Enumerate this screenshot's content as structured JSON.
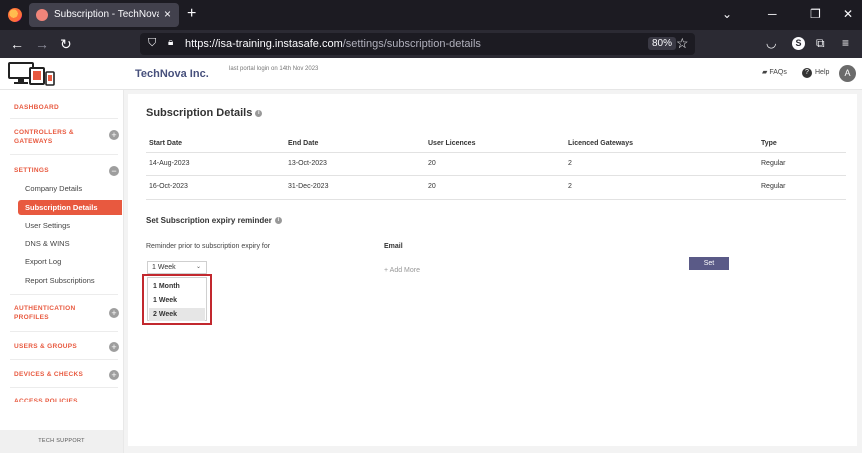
{
  "browser": {
    "tab_title": "Subscription - TechNova Inc. | InstaSafe",
    "tab_close": "×",
    "new_tab": "+",
    "url_host": "https://isa-training.instasafe.com",
    "url_path": "/settings/subscription-details",
    "zoom": "80%",
    "profile_initial": "S"
  },
  "header": {
    "company": "TechNova Inc.",
    "last_login": "last portal login on 14th Nov 2023",
    "faqs": "FAQs",
    "help": "Help",
    "help_glyph": "?",
    "user_initial": "A"
  },
  "sidebar": {
    "dashboard": "DASHBOARD",
    "controllers_line1": "CONTROLLERS &",
    "controllers_line2": "GATEWAYS",
    "settings": "SETTINGS",
    "settings_items": [
      "Company Details",
      "Subscription Details",
      "User Settings",
      "DNS & WINS",
      "Export Log",
      "Report Subscriptions"
    ],
    "auth_line1": "AUTHENTICATION",
    "auth_line2": "PROFILES",
    "users_groups": "USERS & GROUPS",
    "devices_checks": "DEVICES & CHECKS",
    "access_policies": "ACCESS POLICIES",
    "tech_support": "TECH SUPPORT",
    "expand_glyph": "+",
    "collapse_glyph": "−"
  },
  "main": {
    "title": "Subscription Details",
    "info_glyph": "i",
    "columns": [
      "Start Date",
      "End Date",
      "User Licences",
      "Licenced Gateways",
      "Type"
    ],
    "rows": [
      [
        "14-Aug-2023",
        "13-Oct-2023",
        "20",
        "2",
        "Regular"
      ],
      [
        "16-Oct-2023",
        "31-Dec-2023",
        "20",
        "2",
        "Regular"
      ]
    ],
    "reminder_title": "Set Subscription expiry reminder",
    "reminder_label": "Reminder prior to subscription expiry for",
    "email_label": "Email",
    "selected_value": "1 Week",
    "options": [
      "1 Month",
      "1 Week",
      "2 Week"
    ],
    "add_more": "+ Add More",
    "set_button": "Set"
  },
  "colors": {
    "accent": "#e8593f",
    "button": "#5a5a87",
    "highlight_border": "#c2282e",
    "company_text": "#47507c"
  }
}
